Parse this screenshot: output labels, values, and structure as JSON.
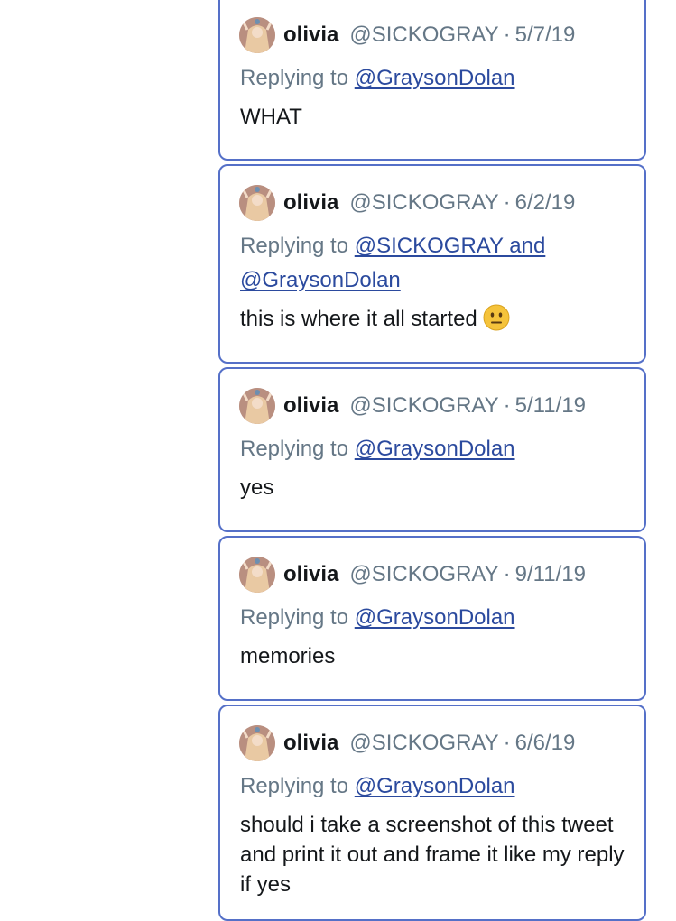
{
  "tweets": [
    {
      "name": "olivia",
      "handle": "@SICKOGRAY",
      "separator": "·",
      "date": "5/7/19",
      "replying_prefix": "Replying to",
      "replying_to": "@GraysonDolan",
      "text": "WHAT"
    },
    {
      "name": "olivia",
      "handle": "@SICKOGRAY",
      "separator": "·",
      "date": "6/2/19",
      "replying_prefix": "Replying to",
      "replying_to": "@SICKOGRAY and",
      "replying_to_2": "@GraysonDolan",
      "text": "this is where it all started",
      "emoji": "neutral-face-emoji"
    },
    {
      "name": "olivia",
      "handle": "@SICKOGRAY",
      "separator": "·",
      "date": "5/11/19",
      "replying_prefix": "Replying to",
      "replying_to": "@GraysonDolan",
      "text": "yes"
    },
    {
      "name": "olivia",
      "handle": "@SICKOGRAY",
      "separator": "·",
      "date": "9/11/19",
      "replying_prefix": "Replying to",
      "replying_to": "@GraysonDolan",
      "text": "memories"
    },
    {
      "name": "olivia",
      "handle": "@SICKOGRAY",
      "separator": "·",
      "date": "6/6/19",
      "replying_prefix": "Replying to",
      "replying_to": "@GraysonDolan",
      "text": "should i take a screenshot of this tweet and print it out and frame it like my reply if yes"
    }
  ],
  "colors": {
    "border": "#5570c8",
    "link": "#2b4a9e",
    "muted": "#657786",
    "text": "#14171a"
  }
}
